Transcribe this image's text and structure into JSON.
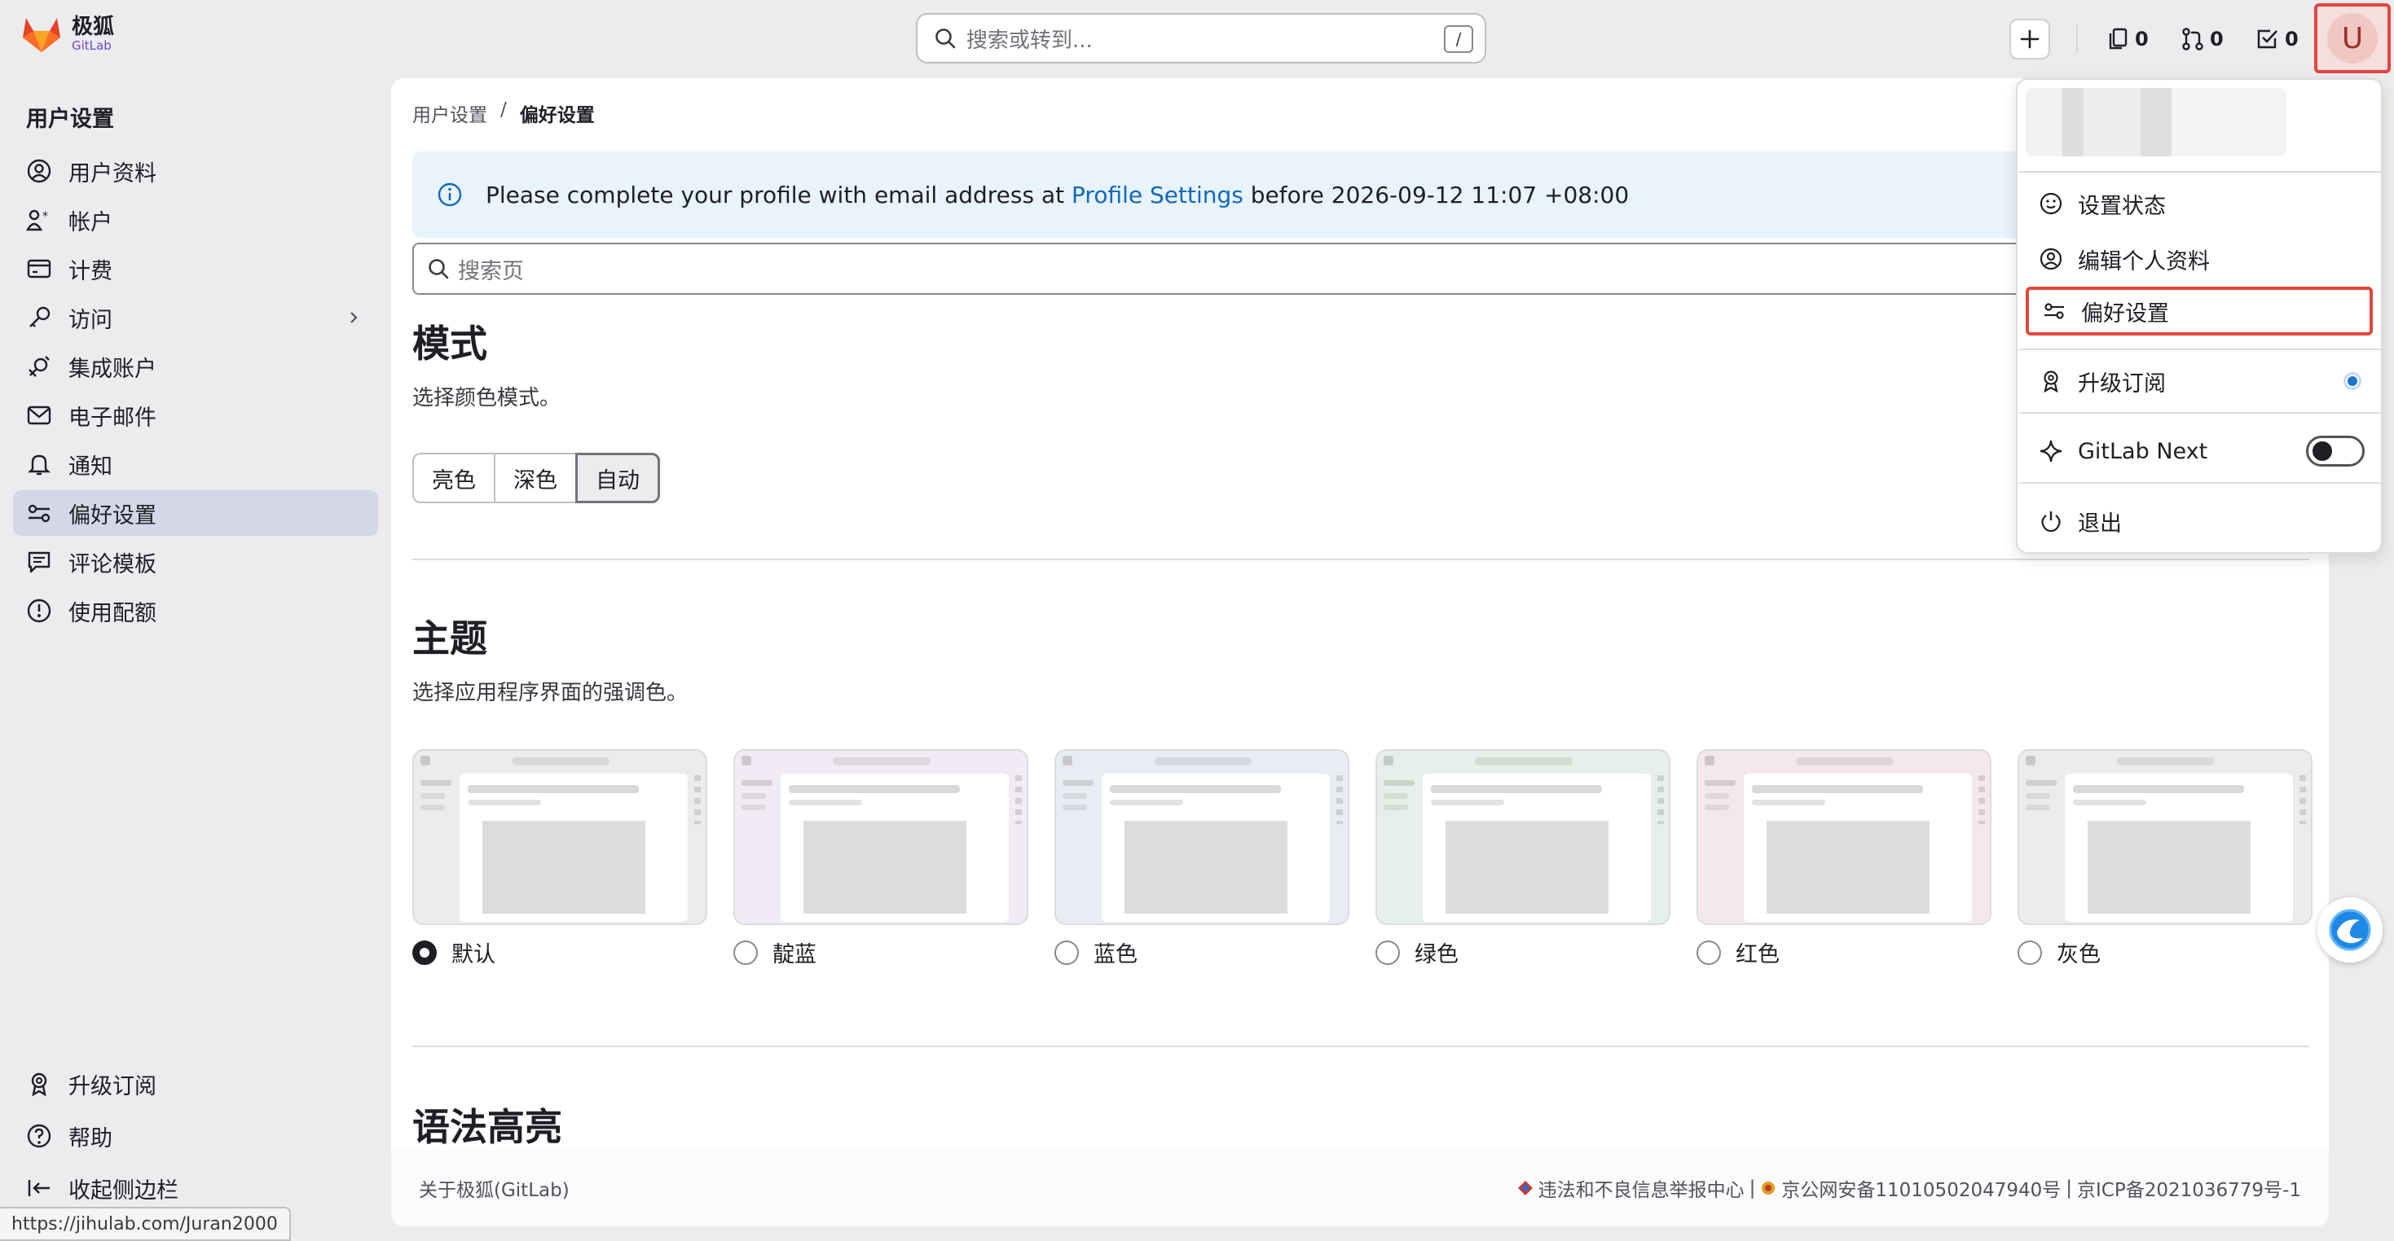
{
  "brand": {
    "name": "极狐",
    "sub": "GitLab"
  },
  "topbar": {
    "search_placeholder": "搜索或转到...",
    "search_shortcut": "/",
    "issues_count": "0",
    "mr_count": "0",
    "todo_count": "0",
    "avatar_letter": "U"
  },
  "sidebar": {
    "heading": "用户设置",
    "items": [
      {
        "label": "用户资料",
        "icon": "profile-icon"
      },
      {
        "label": "帐户",
        "icon": "account-icon"
      },
      {
        "label": "计费",
        "icon": "billing-icon"
      },
      {
        "label": "访问",
        "icon": "key-icon"
      },
      {
        "label": "集成账户",
        "icon": "integration-icon"
      },
      {
        "label": "电子邮件",
        "icon": "mail-icon"
      },
      {
        "label": "通知",
        "icon": "bell-icon"
      },
      {
        "label": "偏好设置",
        "icon": "preferences-icon"
      },
      {
        "label": "评论模板",
        "icon": "comment-icon"
      },
      {
        "label": "使用配额",
        "icon": "quota-icon"
      }
    ],
    "bottom": [
      {
        "label": "升级订阅",
        "icon": "upgrade-icon"
      },
      {
        "label": "帮助",
        "icon": "help-icon"
      },
      {
        "label": "收起侧边栏",
        "icon": "collapse-icon"
      }
    ],
    "status_url": "https://jihulab.com/Juran2000"
  },
  "main": {
    "breadcrumb": {
      "parent": "用户设置",
      "sep": "/",
      "current": "偏好设置"
    },
    "alert": {
      "before": "Please complete your profile with email address at",
      "link": "Profile Settings",
      "after": "before 2026-09-12 11:07 +08:00"
    },
    "page_search_placeholder": "搜索页",
    "mode": {
      "title": "模式",
      "desc": "选择颜色模式。",
      "options": [
        "亮色",
        "深色",
        "自动"
      ],
      "selected": "自动"
    },
    "theme": {
      "title": "主题",
      "desc": "选择应用程序界面的强调色。",
      "options": [
        {
          "label": "默认",
          "color": "#ececef"
        },
        {
          "label": "靛蓝",
          "color": "#f0ebf4"
        },
        {
          "label": "蓝色",
          "color": "#e9ecf2"
        },
        {
          "label": "绿色",
          "color": "#e6efe9"
        },
        {
          "label": "红色",
          "color": "#f4e8ea"
        },
        {
          "label": "灰色",
          "color": "#ececef"
        }
      ],
      "selected": "默认"
    },
    "syntax_title": "语法高亮"
  },
  "footer": {
    "about": "关于极狐(GitLab)",
    "report": "违法和不良信息举报中心",
    "sep1": "|",
    "police": "京公网安备11010502047940号",
    "sep2": "|",
    "icp": "京ICP备2021036779号-1"
  },
  "user_menu": {
    "set_status": "设置状态",
    "edit_profile": "编辑个人资料",
    "preferences": "偏好设置",
    "upgrade": "升级订阅",
    "gitlab_next": "GitLab Next",
    "sign_out": "退出"
  },
  "colors": {
    "accent_red": "#e2463d",
    "link_blue": "#1068bf",
    "active_nav": "#d3d7e8"
  }
}
